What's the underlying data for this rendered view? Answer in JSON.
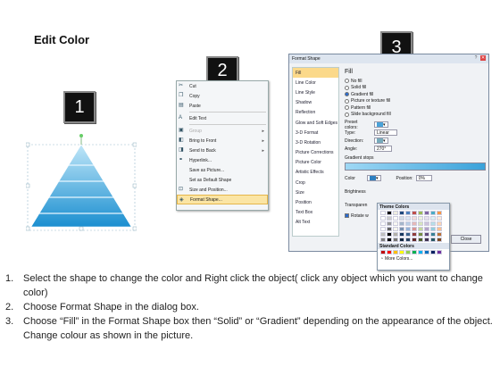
{
  "title": "Edit Color",
  "badges": [
    "1",
    "2",
    "3"
  ],
  "context_menu": {
    "items": [
      {
        "label": "Cut",
        "icon": "scissors-icon"
      },
      {
        "label": "Copy",
        "icon": "copy-icon"
      },
      {
        "label": "Paste",
        "icon": "paste-icon"
      },
      {
        "label": "Edit Text",
        "icon": "edit-text-icon"
      },
      {
        "label": "Group",
        "icon": "group-icon",
        "disabled": true,
        "submenu": true
      },
      {
        "label": "Bring to Front",
        "icon": "bring-front-icon",
        "submenu": true
      },
      {
        "label": "Send to Back",
        "icon": "send-back-icon",
        "submenu": true
      },
      {
        "label": "Hyperlink...",
        "icon": "hyperlink-icon"
      },
      {
        "label": "Save as Picture...",
        "icon": ""
      },
      {
        "label": "Set as Default Shape",
        "icon": ""
      },
      {
        "label": "Size and Position...",
        "icon": "size-icon"
      },
      {
        "label": "Format Shape...",
        "icon": "format-icon",
        "selected": true
      }
    ]
  },
  "dialog": {
    "title": "Format Shape",
    "nav": [
      "Fill",
      "Line Color",
      "Line Style",
      "Shadow",
      "Reflection",
      "Glow and Soft Edges",
      "3-D Format",
      "3-D Rotation",
      "Picture Corrections",
      "Picture Color",
      "Artistic Effects",
      "Crop",
      "Size",
      "Position",
      "Text Box",
      "Alt Text"
    ],
    "fill_header": "Fill",
    "options": [
      "No fill",
      "Solid fill",
      "Gradient fill",
      "Picture or texture fill",
      "Pattern fill",
      "Slide background fill"
    ],
    "selected_option": "Gradient fill",
    "preset_label": "Preset colors:",
    "type_label": "Type:",
    "type_value": "Linear",
    "direction_label": "Direction:",
    "angle_label": "Angle:",
    "angle_value": "270°",
    "gradient_stops_label": "Gradient stops",
    "color_label": "Color",
    "position_label": "Position:",
    "position_value": "0%",
    "brightness_label": "Brightness",
    "transparency_label": "Transparen",
    "rotate_label": "Rotate w",
    "close_label": "Close"
  },
  "palette": {
    "theme_label": "Theme Colors",
    "standard_label": "Standard Colors",
    "more_label": "More Colors...",
    "theme_top": [
      "#ffffff",
      "#000000",
      "#eeece1",
      "#1f497d",
      "#4f81bd",
      "#c0504d",
      "#9bbb59",
      "#8064a2",
      "#4bacc6",
      "#f79646"
    ],
    "standard": [
      "#c00000",
      "#ff0000",
      "#ffc000",
      "#ffff00",
      "#92d050",
      "#00b050",
      "#00b0f0",
      "#0070c0",
      "#002060",
      "#7030a0"
    ]
  },
  "steps": [
    {
      "n": "1.",
      "text": "Select the shape to change the color and Right click the object( click any object which you want to change color)"
    },
    {
      "n": "2.",
      "text": "Choose Format Shape in the dialog box."
    },
    {
      "n": "3.",
      "text": "Choose “Fill” in the Format Shape box then “Solid” or “Gradient” depending on the appearance of the object. Change colour as shown in the picture."
    }
  ]
}
